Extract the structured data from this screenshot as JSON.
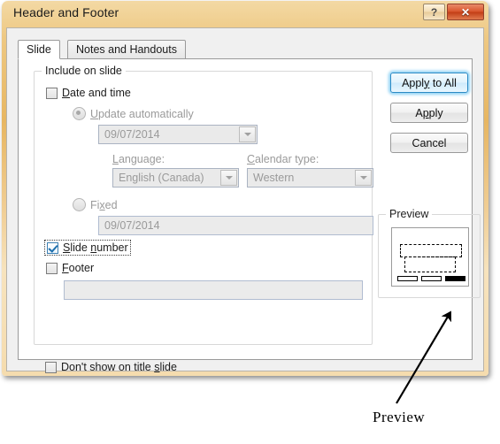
{
  "window": {
    "title": "Header and Footer",
    "help_button": "?",
    "close_button": "✕"
  },
  "tabs": [
    {
      "label": "Slide",
      "active": true
    },
    {
      "label": "Notes and Handouts",
      "active": false
    }
  ],
  "include_group": {
    "label": "Include on slide",
    "date_and_time": {
      "label": "Date and time",
      "checked": false,
      "update_automatically": {
        "label": "Update automatically",
        "selected": true,
        "date_value": "09/07/2014",
        "language_label": "Language:",
        "language_value": "English (Canada)",
        "calendar_label": "Calendar type:",
        "calendar_value": "Western"
      },
      "fixed": {
        "label": "Fixed",
        "selected": false,
        "value": "09/07/2014"
      }
    },
    "slide_number": {
      "label": "Slide number",
      "checked": true,
      "focused": true
    },
    "footer": {
      "label": "Footer",
      "checked": false,
      "value": "",
      "placeholder": ""
    },
    "dont_show_on_title_slide": {
      "label": "Don't show on title slide",
      "checked": false
    }
  },
  "buttons": {
    "apply_to_all": "Apply to All",
    "apply": "Apply",
    "cancel": "Cancel"
  },
  "preview": {
    "group_label": "Preview",
    "bars": [
      "empty",
      "empty",
      "filled"
    ]
  },
  "annotation": {
    "label": "Preview",
    "arrow_color": "#000000"
  },
  "colors": {
    "title_accent": "#e7b661",
    "close_button": "#c23d16",
    "default_button_glow": "#8fd2f5",
    "checkbox_check": "#1e6fad"
  }
}
